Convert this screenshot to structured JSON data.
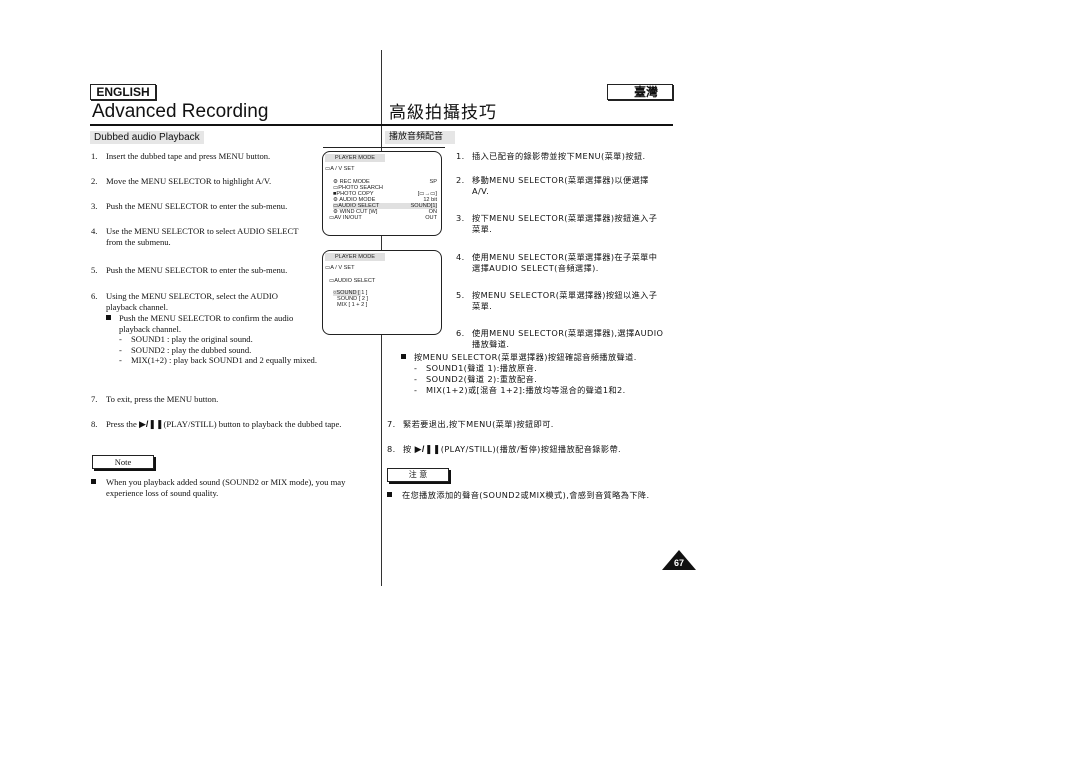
{
  "header": {
    "lang_en": "ENGLISH",
    "lang_tw": "臺灣",
    "title_en": "Advanced Recording",
    "title_tw": "高級拍攝技巧"
  },
  "section": {
    "title_en": "Dubbed audio Playback",
    "title_tw": "播放音頻配音"
  },
  "steps_en": [
    {
      "num": "1.",
      "text": "Insert the dubbed tape and press MENU button."
    },
    {
      "num": "2.",
      "text": "Move the MENU SELECTOR to highlight A/V."
    },
    {
      "num": "3.",
      "text": "Push the MENU SELECTOR to enter the sub-menu."
    },
    {
      "num": "4.",
      "text": "Use the MENU SELECTOR to select AUDIO SELECT",
      "text2": "from the submenu."
    },
    {
      "num": "5.",
      "text": "Push the MENU SELECTOR to enter the sub-menu."
    },
    {
      "num": "6.",
      "text": "Using the MENU SELECTOR, select the AUDIO",
      "text2": "playback channel."
    },
    {
      "num": "7.",
      "text": "To exit, press the MENU button."
    },
    {
      "num": "8.",
      "text_before": "Press the",
      "icon": "▶/❚❚",
      "text_after": "(PLAY/STILL) button to playback the dubbed tape."
    }
  ],
  "sub_en": {
    "bullet": "Push the MENU SELECTOR to confirm the audio",
    "bullet2": "playback channel.",
    "dashes": [
      "SOUND1 : play the original sound.",
      "SOUND2 : play the dubbed sound.",
      "MIX(1+2) : play back SOUND1 and 2 equally mixed."
    ]
  },
  "note_en": {
    "label": "Note",
    "text": "When you playback added sound (SOUND2 or MIX mode), you may",
    "text2": "experience loss of sound quality."
  },
  "steps_tw": [
    {
      "num": "1.",
      "text": "插入已配音的錄影帶並按下MENU(菜單)按鈕."
    },
    {
      "num": "2.",
      "text": "移動MENU SELECTOR(菜單選擇器)以便選擇",
      "text2": "A/V."
    },
    {
      "num": "3.",
      "text": "按下MENU SELECTOR(菜單選擇器)按鈕進入子",
      "text2": "菜單."
    },
    {
      "num": "4.",
      "text": "使用MENU SELECTOR(菜單選擇器)在子菜單中",
      "text2": "選擇AUDIO SELECT(音頻選擇)."
    },
    {
      "num": "5.",
      "text": "按MENU SELECTOR(菜單選擇器)按鈕以進入子",
      "text2": "菜單."
    },
    {
      "num": "6.",
      "text": "使用MENU SELECTOR(菜單選擇器),選擇AUDIO",
      "text2": "播放聲道."
    },
    {
      "num": "7.",
      "text": "緊若要退出,按下MENU(菜單)按鈕即可."
    },
    {
      "num": "8.",
      "text_before": "按",
      "icon": "▶/❚❚",
      "text_after": "(PLAY/STILL)(播放/暫停)按鈕播放配音錄影帶."
    }
  ],
  "sub_tw": {
    "bullet": "按MENU SELECTOR(菜單選擇器)按鈕確認音頻播放聲道.",
    "dashes": [
      "SOUND1(聲道 1):播放原音.",
      "SOUND2(聲道 2):重放配音.",
      "MIX(1+2)或[混音 1+2]:播放均等混合的聲道1和2."
    ]
  },
  "note_tw": {
    "label": "注 意",
    "text": "在您播放添加的聲音(SOUND2或MIX模式),會感到音質略為下降."
  },
  "osd1": {
    "header": "PLAYER MODE",
    "folder": "A / V SET",
    "items": [
      {
        "label": "REC MODE",
        "value": "SP",
        "icon": "gear-icon"
      },
      {
        "label": "PHOTO SEARCH",
        "value": "",
        "icon": "box-icon"
      },
      {
        "label": "PHOTO COPY",
        "value": "[▭→▭]",
        "icon": "square-icon"
      },
      {
        "label": "AUDIO MODE",
        "value": "12 bit",
        "icon": "gear-icon"
      },
      {
        "label": "AUDIO SELECT",
        "value": "SOUND[1]",
        "icon": "box-icon",
        "highlight": true
      },
      {
        "label": "WIND CUT [W]",
        "value": "ON",
        "icon": "gear-icon"
      },
      {
        "label": "AV IN/OUT",
        "value": "OUT",
        "icon": "box-icon"
      }
    ]
  },
  "osd2": {
    "header": "PLAYER MODE",
    "folder": "A / V SET",
    "subfolder": "AUDIO SELECT",
    "options": [
      {
        "label": "SOUND [ 1 ]",
        "selected": true
      },
      {
        "label": "SOUND [ 2 ]",
        "selected": false
      },
      {
        "label": "MIX [ 1 + 2 ]",
        "selected": false
      }
    ]
  },
  "page_number": "67"
}
